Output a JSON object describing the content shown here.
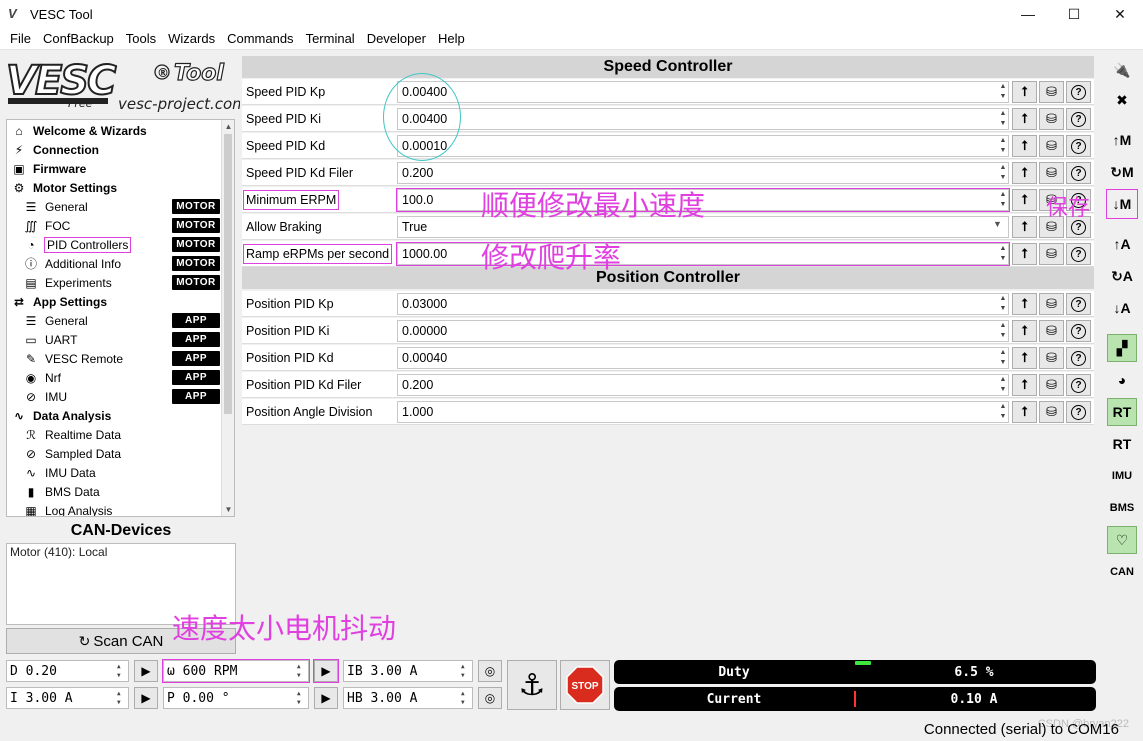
{
  "window": {
    "title": "VESC Tool",
    "min": "—",
    "max": "☐",
    "close": "✕"
  },
  "menu": [
    "File",
    "ConfBackup",
    "Tools",
    "Wizards",
    "Commands",
    "Terminal",
    "Developer",
    "Help"
  ],
  "logo": {
    "brand": "VESC",
    "reg": "®",
    "tool": "Tool",
    "free": "Free",
    "site": "vesc-project.com"
  },
  "tree": {
    "items": [
      {
        "label": "Welcome & Wizards",
        "level": "top",
        "icon": "home-icon",
        "glyph": "⌂"
      },
      {
        "label": "Connection",
        "level": "top",
        "icon": "plug-icon",
        "glyph": "⚡"
      },
      {
        "label": "Firmware",
        "level": "top",
        "icon": "chip-icon",
        "glyph": "▣"
      },
      {
        "label": "Motor Settings",
        "level": "top",
        "icon": "motor-icon",
        "glyph": "⚙"
      },
      {
        "label": "General",
        "level": "sub",
        "icon": "sliders-icon",
        "glyph": "☰",
        "badge": "MOTOR"
      },
      {
        "label": "FOC",
        "level": "sub",
        "icon": "coil-icon",
        "glyph": "∭",
        "badge": "MOTOR"
      },
      {
        "label": "PID Controllers",
        "level": "sub",
        "icon": "gauge-icon",
        "glyph": "◔",
        "badge": "MOTOR",
        "selected": true
      },
      {
        "label": "Additional Info",
        "level": "sub",
        "icon": "info-icon",
        "glyph": "ⓘ",
        "badge": "MOTOR"
      },
      {
        "label": "Experiments",
        "level": "sub",
        "icon": "flask-icon",
        "glyph": "▤",
        "badge": "MOTOR"
      },
      {
        "label": "App Settings",
        "level": "top",
        "icon": "arrows-icon",
        "glyph": "⇄"
      },
      {
        "label": "General",
        "level": "sub",
        "icon": "sliders-icon",
        "glyph": "☰",
        "badge": "APP"
      },
      {
        "label": "UART",
        "level": "sub",
        "icon": "uart-icon",
        "glyph": "▭",
        "badge": "APP"
      },
      {
        "label": "VESC Remote",
        "level": "sub",
        "icon": "remote-icon",
        "glyph": "✎",
        "badge": "APP"
      },
      {
        "label": "Nrf",
        "level": "sub",
        "icon": "wireless-icon",
        "glyph": "◉",
        "badge": "APP"
      },
      {
        "label": "IMU",
        "level": "sub",
        "icon": "imu-icon",
        "glyph": "⊘",
        "badge": "APP"
      },
      {
        "label": "Data Analysis",
        "level": "top",
        "icon": "chart-icon",
        "glyph": "∿"
      },
      {
        "label": "Realtime Data",
        "level": "sub",
        "icon": "realtime-icon",
        "glyph": "ℛ"
      },
      {
        "label": "Sampled Data",
        "level": "sub",
        "icon": "sampled-icon",
        "glyph": "⊘"
      },
      {
        "label": "IMU Data",
        "level": "sub",
        "icon": "imu-data-icon",
        "glyph": "∿"
      },
      {
        "label": "BMS Data",
        "level": "sub",
        "icon": "battery-icon",
        "glyph": "▮"
      },
      {
        "label": "Log Analysis",
        "level": "sub",
        "icon": "map-icon",
        "glyph": "▦"
      }
    ]
  },
  "can": {
    "title": "CAN-Devices",
    "device": "Motor (410): Local",
    "scan_label": "Scan CAN",
    "scan_glyph": "↻"
  },
  "speed": {
    "title": "Speed Controller",
    "rows": [
      {
        "label": "Speed PID Kp",
        "value": "0.00400"
      },
      {
        "label": "Speed PID Ki",
        "value": "0.00400"
      },
      {
        "label": "Speed PID Kd",
        "value": "0.00010"
      },
      {
        "label": "Speed PID Kd Filer",
        "value": "0.200"
      },
      {
        "label": "Minimum ERPM",
        "value": "100.0",
        "marked": true
      },
      {
        "label": "Allow Braking",
        "value": "True",
        "combo": true
      },
      {
        "label": "Ramp eRPMs per second",
        "value": "1000.00",
        "marked": true
      }
    ]
  },
  "position": {
    "title": "Position Controller",
    "rows": [
      {
        "label": "Position PID Kp",
        "value": "0.03000"
      },
      {
        "label": "Position PID Ki",
        "value": "0.00000"
      },
      {
        "label": "Position PID Kd",
        "value": "0.00040"
      },
      {
        "label": "Position PID Kd Filer",
        "value": "0.200"
      },
      {
        "label": "Position Angle Division",
        "value": "1.000"
      }
    ]
  },
  "row_buttons": {
    "upload": "⭡",
    "reset": "⛁",
    "help": "?"
  },
  "annotations": {
    "min_speed": "顺便修改最小速度",
    "save": "保存",
    "ramp": "修改爬升率",
    "jitter": "速度太小电机抖动"
  },
  "toolbar": [
    {
      "name": "connect-icon",
      "glyph": "🔌"
    },
    {
      "name": "disconnect-icon",
      "glyph": "✖"
    },
    {
      "name": "read-motor-config-icon",
      "glyph": "↑M"
    },
    {
      "name": "read-default-motor-config-icon",
      "glyph": "↻M"
    },
    {
      "name": "write-motor-config-icon",
      "glyph": "↓M",
      "marked": true
    },
    {
      "name": "read-app-config-icon",
      "glyph": "↑A"
    },
    {
      "name": "read-default-app-config-icon",
      "glyph": "↻A"
    },
    {
      "name": "write-app-config-icon",
      "glyph": "↓A"
    },
    {
      "name": "can-fwd-icon",
      "glyph": "▞",
      "green": true
    },
    {
      "name": "gamepad-icon",
      "glyph": "◕"
    },
    {
      "name": "rt-data-icon",
      "glyph": "RT",
      "green": true
    },
    {
      "name": "rt-app-icon",
      "glyph": "RT"
    },
    {
      "name": "imu-toolbar-icon",
      "glyph": "IMU"
    },
    {
      "name": "bms-toolbar-icon",
      "glyph": "BMS"
    },
    {
      "name": "heart-icon",
      "glyph": "♡",
      "green": true
    },
    {
      "name": "can-toolbar-icon",
      "glyph": "CAN"
    }
  ],
  "controls": {
    "duty": "D 0.20",
    "rpm": "ω  600 RPM",
    "ib": "IB 3.00 A",
    "current": "I 3.00 A",
    "pos": "P 0.00 °",
    "hb": "HB 3.00 A",
    "play": "▶",
    "brake": "◎",
    "anchor": "⚓",
    "stop": "STOP"
  },
  "gauges": [
    {
      "label": "Duty",
      "value": "6.5 %"
    },
    {
      "label": "Current",
      "value": "0.10 A"
    }
  ],
  "status": {
    "text": "Connected (serial) to COM16",
    "watermark": "CSDN @bryan222"
  }
}
